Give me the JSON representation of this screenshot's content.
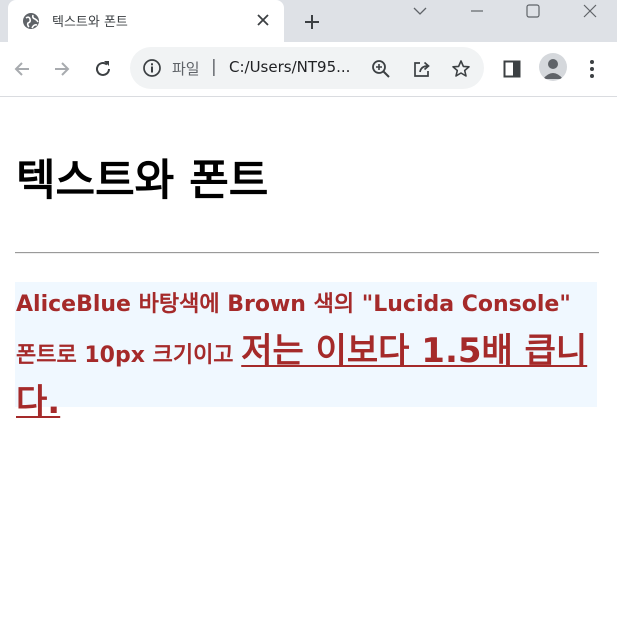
{
  "browser": {
    "tab": {
      "title": "텍스트와 폰트"
    },
    "address": {
      "scheme_label": "파일",
      "separator": "|",
      "url": "C:/Users/NT95..."
    }
  },
  "page": {
    "heading": "텍스트와 폰트",
    "paragraph": {
      "text_1": "AliceBlue 바탕색에 Brown 색의 \"Lucida Console\" 폰트로 10px 크기이고 ",
      "text_big": "저는 이보다 1.5배 큽니다."
    }
  },
  "colors": {
    "paragraph_background": "#f0f8ff",
    "paragraph_text": "#a52a2a",
    "tabstrip": "#dee1e6"
  },
  "icons": [
    "globe-icon",
    "close-icon",
    "plus-icon",
    "chevron-down-icon",
    "minimize-icon",
    "maximize-icon",
    "window-close-icon",
    "back-icon",
    "forward-icon",
    "reload-icon",
    "info-icon",
    "zoom-icon",
    "share-icon",
    "star-icon",
    "side-panel-icon",
    "profile-icon",
    "more-icon"
  ]
}
